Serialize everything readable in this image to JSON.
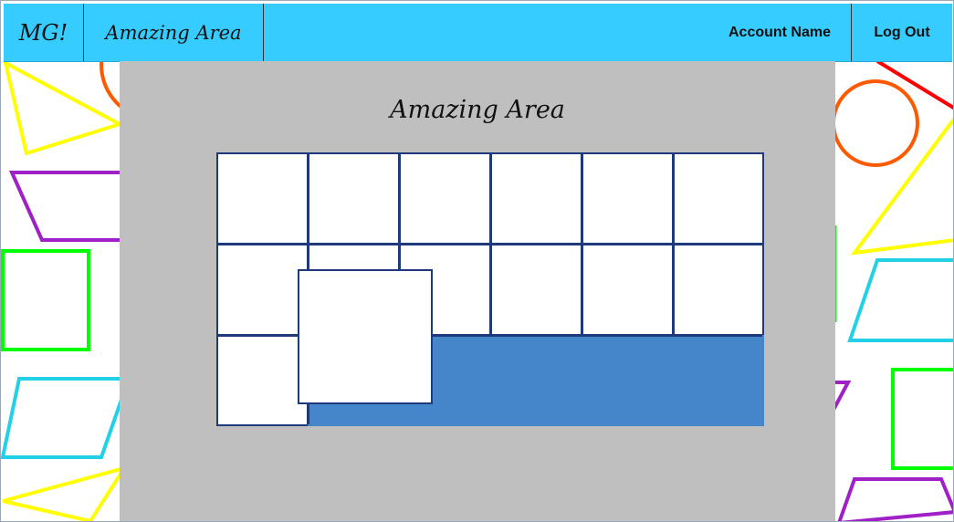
{
  "header": {
    "logo_text": "MG!",
    "app_title": "Amazing Area",
    "account_label": "Account Name",
    "logout_label": "Log Out"
  },
  "main": {
    "title": "Amazing Area",
    "grid": {
      "columns": 6,
      "rows": 3,
      "filled_region": "bottom row, columns 2-6"
    }
  },
  "colors": {
    "header_bg": "#37ccff",
    "panel_bg": "#bfbfbf",
    "grid_line": "#1f3a7a",
    "fill_blue": "#4586ca"
  }
}
